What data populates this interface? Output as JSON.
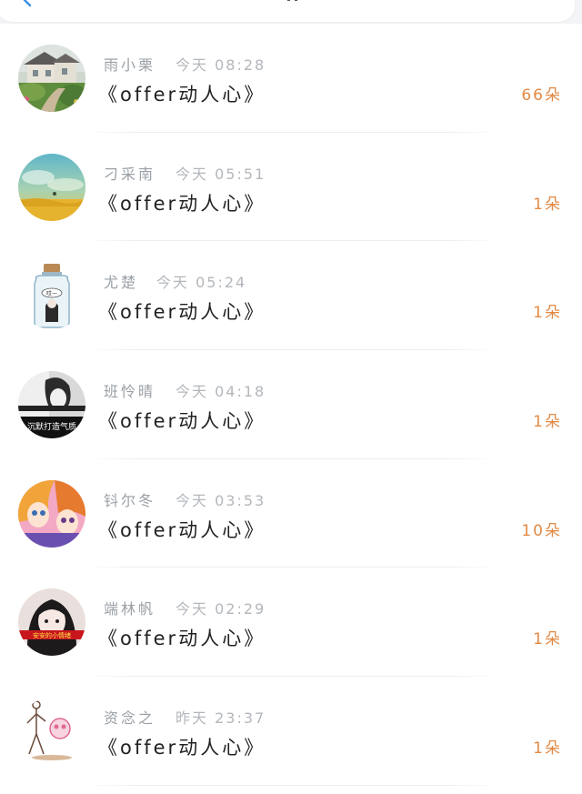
{
  "header": {
    "back_icon": "chevron-left-icon"
  },
  "colors": {
    "accent": "#e28a45",
    "name_gray": "#9aa0a6",
    "time_gray": "#b3b7bc",
    "text_dark": "#222222"
  },
  "items": [
    {
      "name": "雨小栗",
      "time": "今天 08:28",
      "work": "《offer动人心》",
      "count": "66朵"
    },
    {
      "name": "刁采南",
      "time": "今天 05:51",
      "work": "《offer动人心》",
      "count": "1朵"
    },
    {
      "name": "尤楚",
      "time": "今天 05:24",
      "work": "《offer动人心》",
      "count": "1朵"
    },
    {
      "name": "班怜晴",
      "time": "今天 04:18",
      "work": "《offer动人心》",
      "count": "1朵"
    },
    {
      "name": "钭尔冬",
      "time": "今天 03:53",
      "work": "《offer动人心》",
      "count": "10朵"
    },
    {
      "name": "端林帆",
      "time": "今天 02:29",
      "work": "《offer动人心》",
      "count": "1朵"
    },
    {
      "name": "资念之",
      "time": "昨天 23:37",
      "work": "《offer动人心》",
      "count": "1朵"
    }
  ],
  "avatar_texts": {
    "bottle": "哎一",
    "mono": "沉默打造气质",
    "girl": "安安的小情绪"
  }
}
